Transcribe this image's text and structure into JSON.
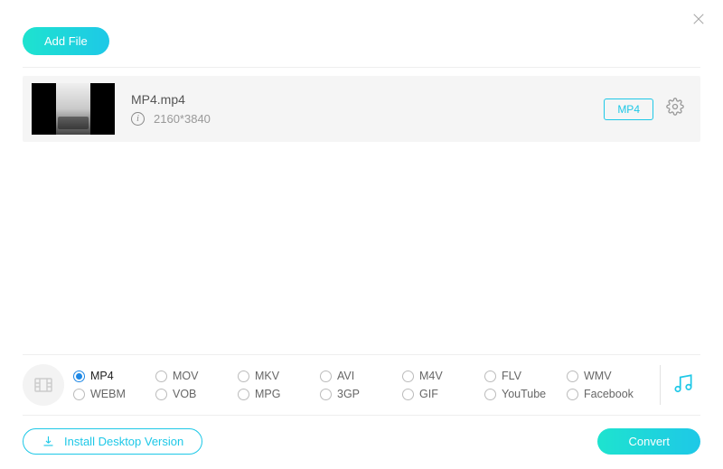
{
  "header": {
    "add_file_label": "Add File"
  },
  "file": {
    "name": "MP4.mp4",
    "resolution": "2160*3840",
    "output_format": "MP4"
  },
  "formats": {
    "selected": "MP4",
    "row1": [
      "MP4",
      "MOV",
      "MKV",
      "AVI",
      "M4V",
      "FLV",
      "WMV"
    ],
    "row2": [
      "WEBM",
      "VOB",
      "MPG",
      "3GP",
      "GIF",
      "YouTube",
      "Facebook"
    ]
  },
  "actions": {
    "install_label": "Install Desktop Version",
    "convert_label": "Convert"
  }
}
